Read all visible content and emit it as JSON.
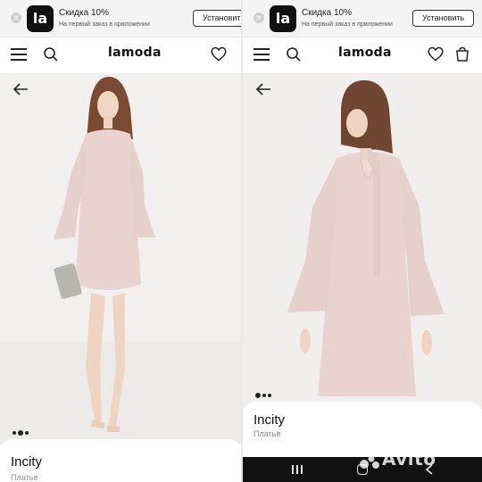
{
  "promo": {
    "logo_text": "la",
    "title": "Скидка 10%",
    "subtitle": "На первый заказ в приложении",
    "install_label": "Установить",
    "close_icon": "close-icon"
  },
  "header": {
    "brand": "lamoda",
    "icons": [
      "menu-icon",
      "search-icon",
      "heart-icon",
      "shopping-bag-icon"
    ]
  },
  "product": {
    "brand": "Incity",
    "type": "Платье",
    "color": "#e8d3cf"
  },
  "left_gallery": {
    "image_count": 3,
    "active_index": 1
  },
  "right_gallery": {
    "image_count": 3,
    "active_index": 0
  },
  "watermark": "Avito",
  "colors": {
    "accent": "#111111",
    "background": "#f1efee",
    "nav": "#111111"
  }
}
